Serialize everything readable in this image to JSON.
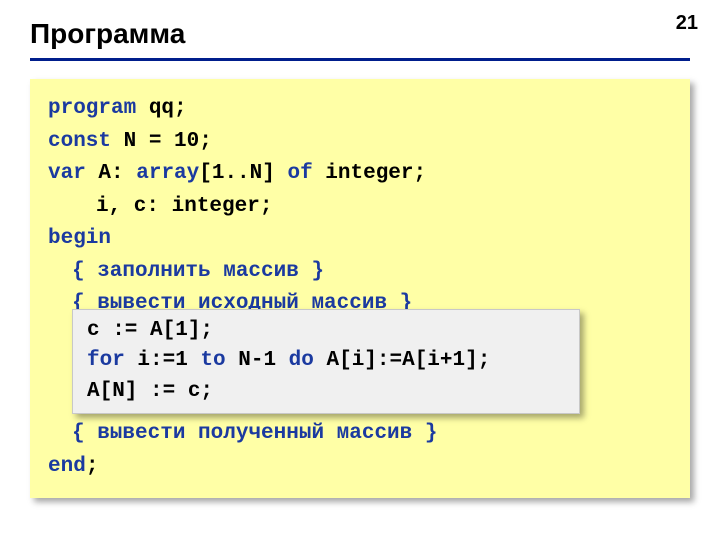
{
  "page_number": "21",
  "title": "Программа",
  "code": {
    "l1_kw": "program",
    "l1_rest": " qq;",
    "l2_kw": "const",
    "l2_rest": " N = 10;",
    "l3_kw": "var",
    "l3_rest": " A: ",
    "l3_kw2": "array",
    "l3_rest2": "[1..N] ",
    "l3_kw3": "of",
    "l3_rest3": " integer;",
    "l4": "i, c: integer;",
    "l5_kw": "begin",
    "c1": "{ заполнить массив }",
    "c2": "{ вывести исходный массив }",
    "spacer1": " ",
    "spacer2": " ",
    "spacer3": " ",
    "c3": "{ вывести полученный массив }",
    "l_end_kw": "end",
    "l_end_rest": ";"
  },
  "inset": {
    "l1": "c := A[1];",
    "l2a": "for",
    "l2b": " i:=1 ",
    "l2c": "to",
    "l2d": " N-1 ",
    "l2e": "do",
    "l2f": " A[i]:=A[i+1];",
    "l3": "A[N] := c;"
  }
}
